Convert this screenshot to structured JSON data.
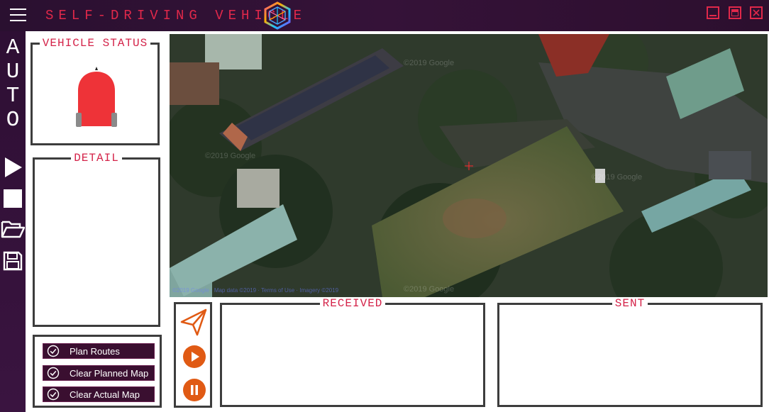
{
  "window": {
    "title": "SELF-DRIVING VEHICLE",
    "menu_icon": "hamburger-icon",
    "logo_icon": "hexagon-logo-icon",
    "controls": [
      "minimize-icon",
      "maximize-icon",
      "close-icon"
    ]
  },
  "sidebar": {
    "mode_letters": [
      "A",
      "U",
      "T",
      "O"
    ],
    "icons": [
      "play-icon",
      "stop-icon",
      "folder-open-icon",
      "save-icon"
    ]
  },
  "vehicle_status": {
    "title": "VEHICLE STATUS",
    "vehicle_icon": "car-top-view-icon"
  },
  "detail": {
    "title": "DETAIL"
  },
  "controls": {
    "buttons": [
      {
        "label": "Plan Routes",
        "icon": "check-circle-icon"
      },
      {
        "label": "Clear Planned Map",
        "icon": "check-circle-icon"
      },
      {
        "label": "Clear Actual Map",
        "icon": "check-circle-icon"
      }
    ]
  },
  "comm": {
    "icons": [
      "send-icon",
      "play-circle-icon",
      "pause-circle-icon"
    ],
    "received_title": "RECEIVED",
    "sent_title": "SENT"
  },
  "map": {
    "type": "satellite",
    "marker_icon": "crosshair-icon"
  },
  "colors": {
    "accent": "#e0284a",
    "title_text": "#d4244a",
    "titlebar_bg": "#2a1030",
    "sidebar_bg": "#2e0f34",
    "button_bg": "#3a0f30",
    "orange": "#e05a14",
    "vehicle": "#ee3338"
  }
}
